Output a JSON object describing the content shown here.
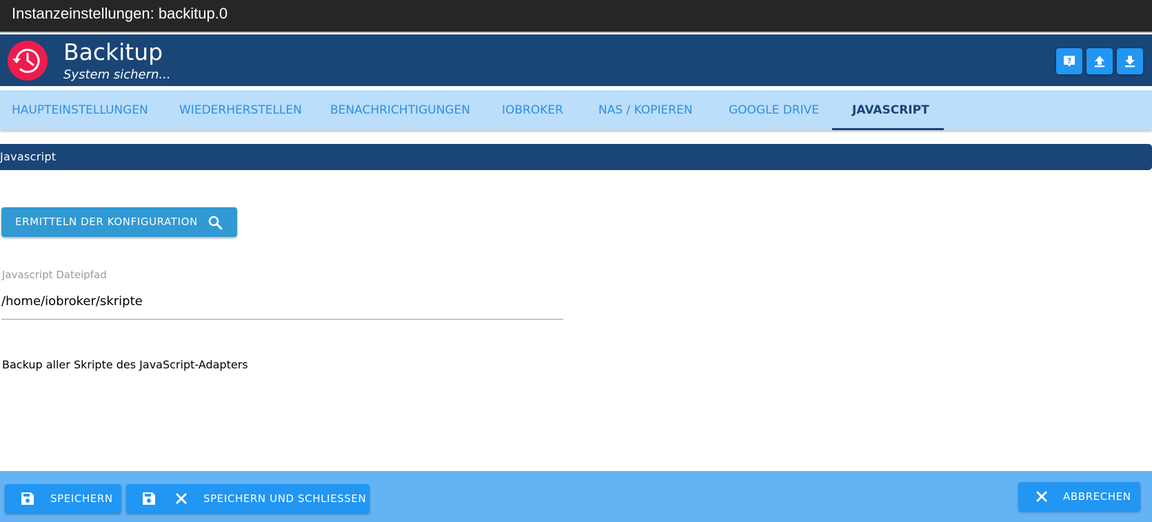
{
  "window": {
    "title": "Instanzeinstellungen: backitup.0"
  },
  "header": {
    "app_name": "Backitup",
    "subtitle": "System sichern...",
    "logo_icon": "backup-clock-icon",
    "buttons": [
      {
        "name": "help",
        "icon": "help-icon"
      },
      {
        "name": "upload",
        "icon": "upload-icon"
      },
      {
        "name": "download",
        "icon": "download-icon"
      }
    ]
  },
  "tabs": [
    {
      "label": "HAUPTEINSTELLUNGEN",
      "active": false
    },
    {
      "label": "WIEDERHERSTELLEN",
      "active": false
    },
    {
      "label": "BENACHRICHTIGUNGEN",
      "active": false
    },
    {
      "label": "IOBROKER",
      "active": false
    },
    {
      "label": "NAS / KOPIEREN",
      "active": false
    },
    {
      "label": "GOOGLE DRIVE",
      "active": false
    },
    {
      "label": "JAVASCRIPT",
      "active": true
    }
  ],
  "main": {
    "section_title": "Javascript",
    "detect_button": {
      "label": "ERMITTELN DER KONFIGURATION",
      "icon": "search-icon"
    },
    "path_field": {
      "label": "Javascript Dateipfad",
      "value": "/home/iobroker/skripte"
    },
    "description": "Backup aller Skripte des JavaScript-Adapters"
  },
  "footer": {
    "save_label": "SPEICHERN",
    "save_close_label": "SPEICHERN UND SCHLIESSEN",
    "cancel_label": "ABBRECHEN"
  },
  "colors": {
    "titlebar": "#262626",
    "header": "#1a4577",
    "tabs_bg": "#bbdefb",
    "tab_text": "#2f8fe0",
    "accent_button": "#2196f3",
    "footer": "#64b3f5",
    "logo": "#ed1c4e"
  }
}
